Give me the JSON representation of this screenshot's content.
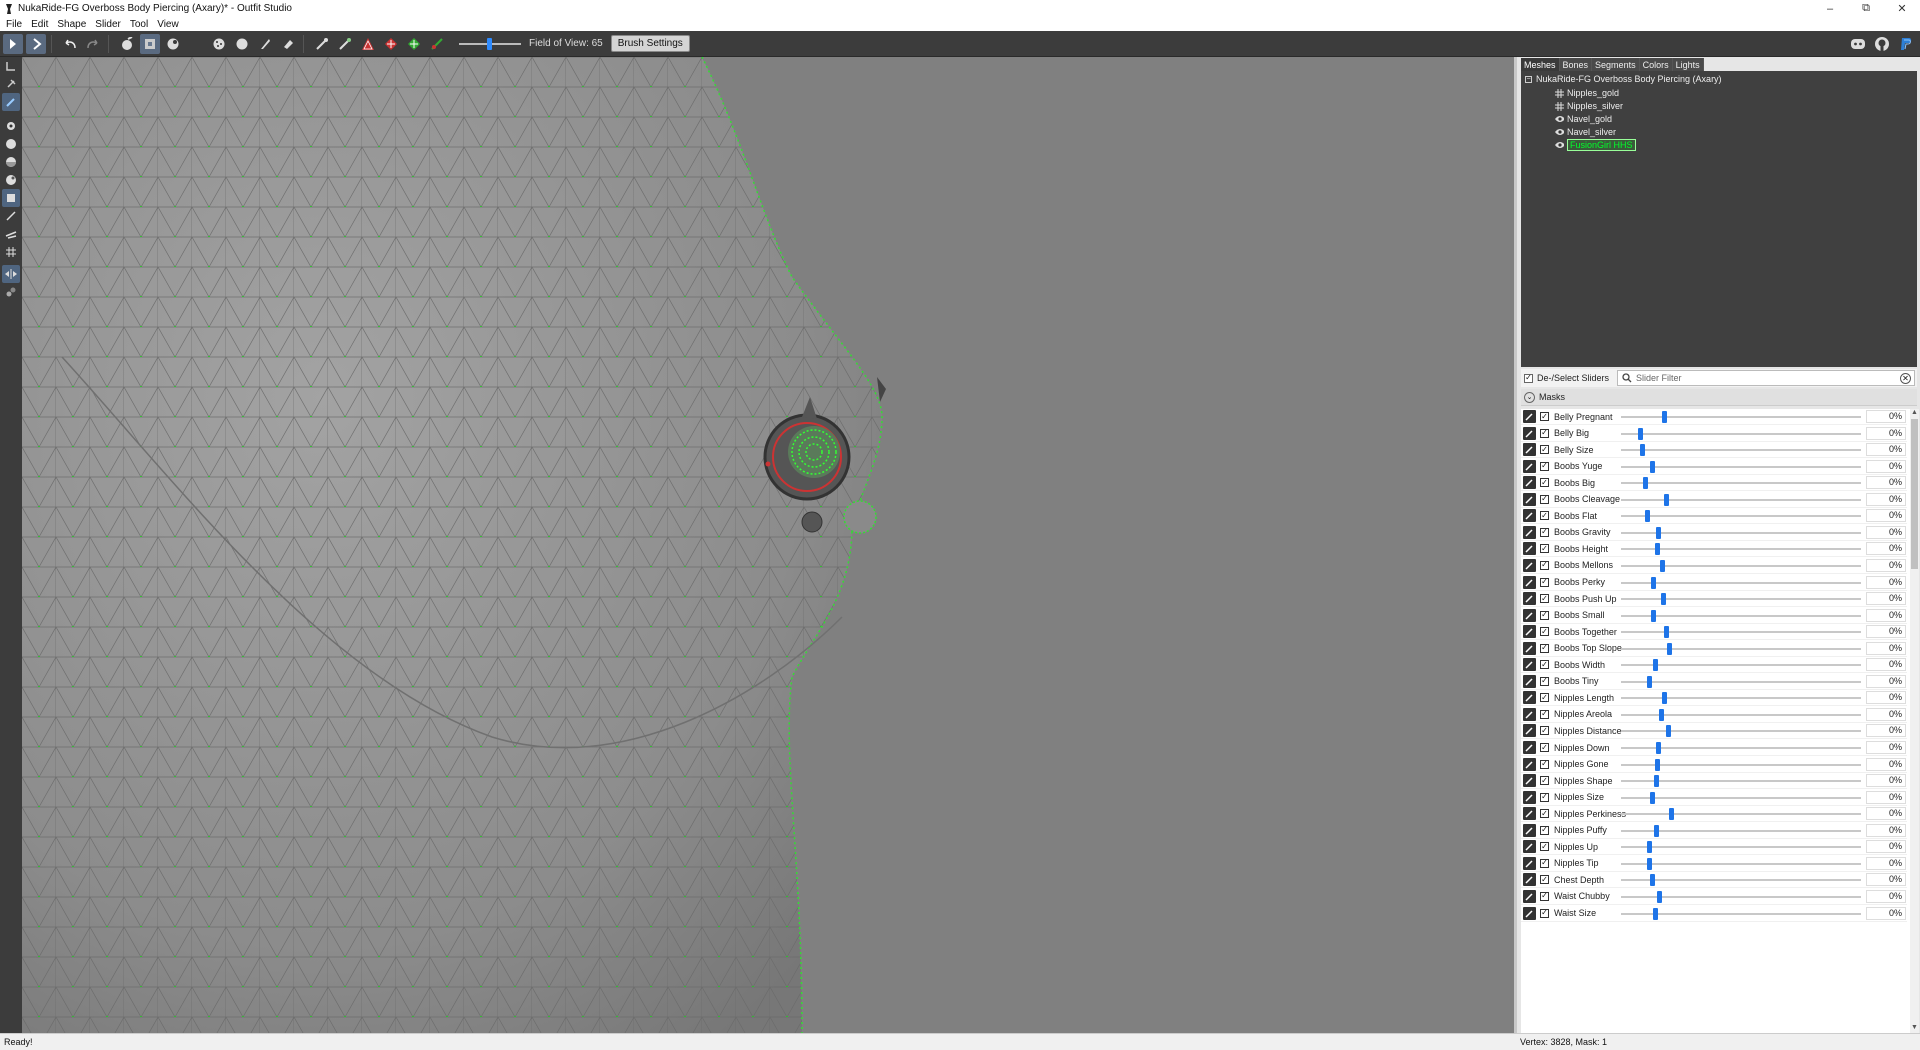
{
  "window": {
    "title": "NukaRide-FG Overboss Body Piercing (Axary)* - Outfit Studio",
    "controls": [
      "minimize-icon",
      "restore-icon",
      "close-icon"
    ]
  },
  "menubar": [
    "File",
    "Edit",
    "Shape",
    "Slider",
    "Tool",
    "View"
  ],
  "toolbar": {
    "field_of_view_label": "Field of View: 65",
    "field_of_view_value": 65,
    "brush_settings_label": "Brush Settings",
    "right_icons": [
      "discord-icon",
      "github-icon",
      "paypal-icon"
    ]
  },
  "panel": {
    "tabs": [
      "Meshes",
      "Bones",
      "Segments",
      "Colors",
      "Lights"
    ],
    "active_tab": "Meshes",
    "tree_root": "NukaRide-FG Overboss Body Piercing (Axary)",
    "meshes": [
      {
        "label": "Nipples_gold",
        "icon": "grid-icon",
        "selected": false
      },
      {
        "label": "Nipples_silver",
        "icon": "grid-icon",
        "selected": false
      },
      {
        "label": "Navel_gold",
        "icon": "eye-icon",
        "selected": false
      },
      {
        "label": "Navel_silver",
        "icon": "eye-icon",
        "selected": false
      },
      {
        "label": "FusionGirl HHS",
        "icon": "eye-icon",
        "selected": true
      }
    ],
    "deselect_label": "De-/Select Sliders",
    "filter_placeholder": "Slider Filter",
    "masks_label": "Masks",
    "sliders": [
      {
        "name": "Belly Pregnant",
        "value": "0%"
      },
      {
        "name": "Belly Big",
        "value": "0%"
      },
      {
        "name": "Belly Size",
        "value": "0%"
      },
      {
        "name": "Boobs Yuge",
        "value": "0%"
      },
      {
        "name": "Boobs Big",
        "value": "0%"
      },
      {
        "name": "Boobs Cleavage",
        "value": "0%"
      },
      {
        "name": "Boobs Flat",
        "value": "0%"
      },
      {
        "name": "Boobs Gravity",
        "value": "0%"
      },
      {
        "name": "Boobs Height",
        "value": "0%"
      },
      {
        "name": "Boobs Mellons",
        "value": "0%"
      },
      {
        "name": "Boobs Perky",
        "value": "0%"
      },
      {
        "name": "Boobs Push Up",
        "value": "0%"
      },
      {
        "name": "Boobs Small",
        "value": "0%"
      },
      {
        "name": "Boobs Together",
        "value": "0%"
      },
      {
        "name": "Boobs Top Slope",
        "value": "0%"
      },
      {
        "name": "Boobs Width",
        "value": "0%"
      },
      {
        "name": "Boobs Tiny",
        "value": "0%"
      },
      {
        "name": "Nipples Length",
        "value": "0%"
      },
      {
        "name": "Nipples Areola",
        "value": "0%"
      },
      {
        "name": "Nipples Distance",
        "value": "0%"
      },
      {
        "name": "Nipples Down",
        "value": "0%"
      },
      {
        "name": "Nipples Gone",
        "value": "0%"
      },
      {
        "name": "Nipples Shape",
        "value": "0%"
      },
      {
        "name": "Nipples Size",
        "value": "0%"
      },
      {
        "name": "Nipples Perkiness",
        "value": "0%"
      },
      {
        "name": "Nipples Puffy",
        "value": "0%"
      },
      {
        "name": "Nipples Up",
        "value": "0%"
      },
      {
        "name": "Nipples Tip",
        "value": "0%"
      },
      {
        "name": "Chest Depth",
        "value": "0%"
      },
      {
        "name": "Waist Chubby",
        "value": "0%"
      },
      {
        "name": "Waist Size",
        "value": "0%"
      }
    ]
  },
  "status": {
    "left": "Ready!",
    "right": "Vertex: 3828, Mask: 1"
  },
  "colors": {
    "wireframe_vertex": "#00e020",
    "slider_thumb": "#1e74e8",
    "selected_mesh": "#00ff2a"
  }
}
